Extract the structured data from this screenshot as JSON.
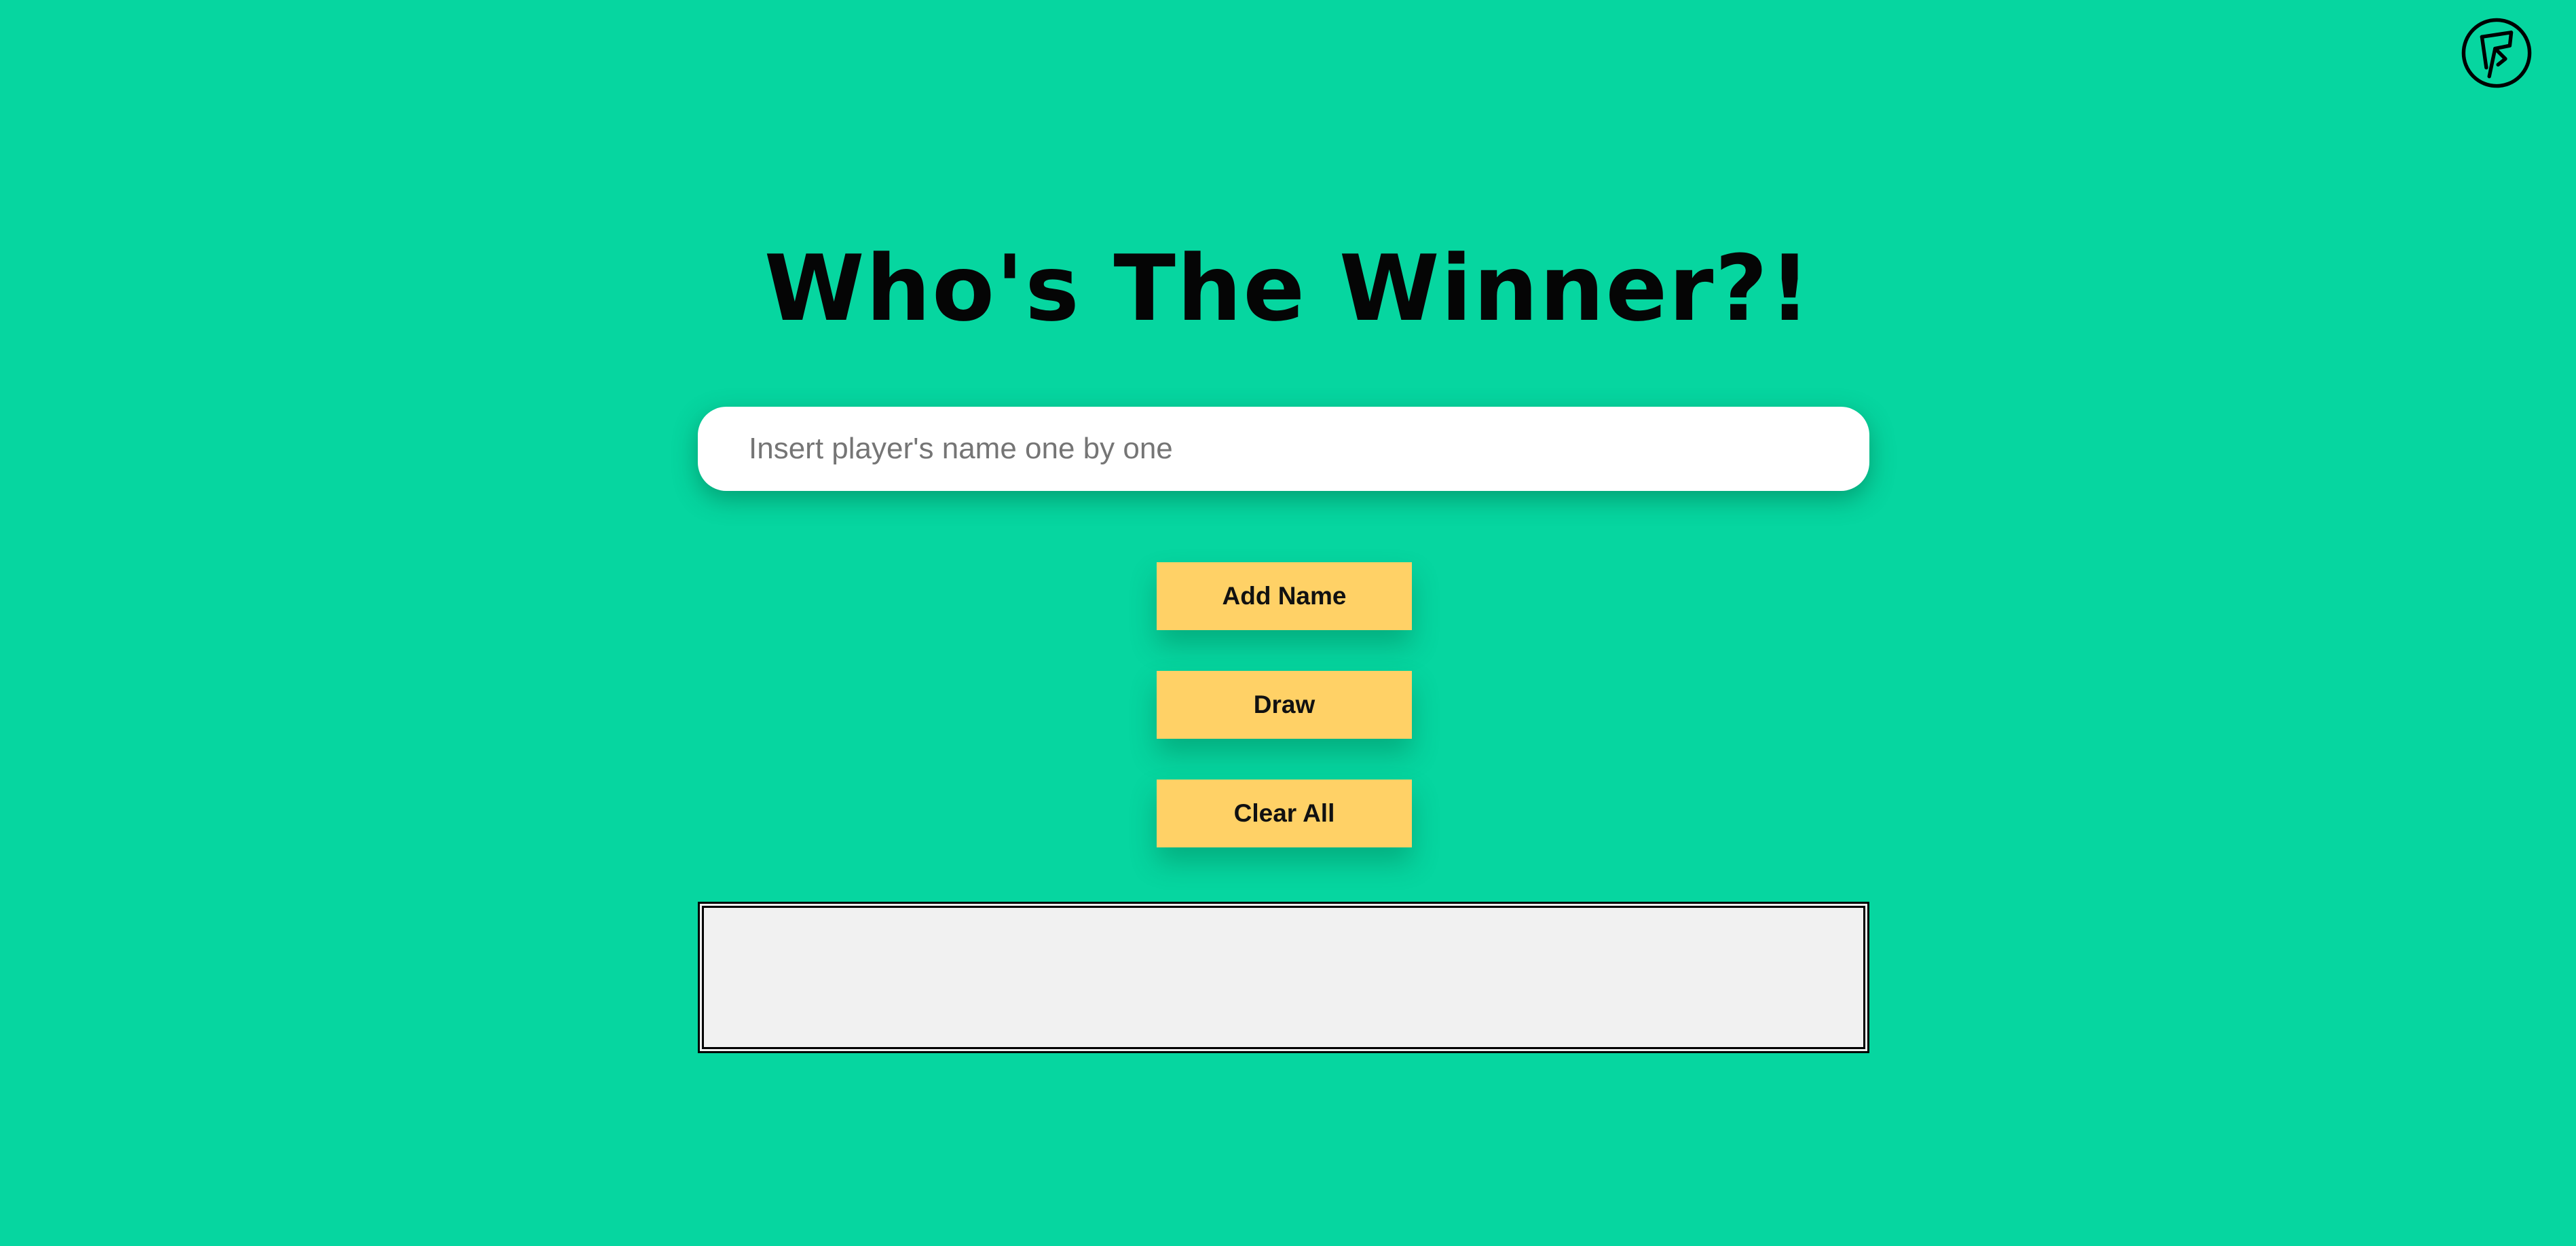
{
  "app": {
    "title": "Who's The Winner?!"
  },
  "logo": {
    "icon": "circle-monogram-logo-icon"
  },
  "form": {
    "name_input_value": "",
    "name_input_placeholder": "Insert player's name one by one"
  },
  "buttons": {
    "add_name": "Add Name",
    "draw": "Draw",
    "clear_all": "Clear All"
  },
  "result": {
    "text": ""
  },
  "colors": {
    "background": "#06d6a0",
    "button": "#ffd166",
    "input": "#ffffff",
    "result_box": "#f1f1f1"
  }
}
